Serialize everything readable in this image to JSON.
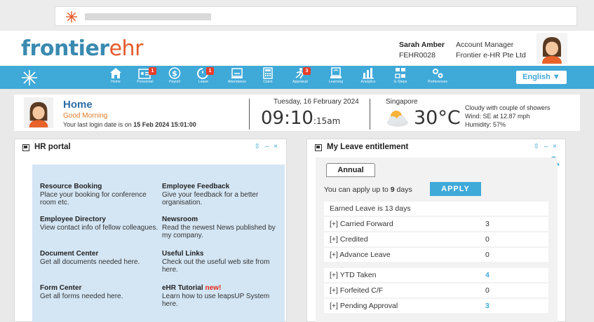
{
  "header": {
    "logo_part1": "frontier",
    "logo_part2": "ehr",
    "user_name": "Sarah Amber",
    "user_id": "FEHR0028",
    "role": "Account Manager",
    "company": "Frontier e-HR Pte Ltd"
  },
  "toolbar": {
    "items": [
      {
        "label": "Home",
        "badge": ""
      },
      {
        "label": "Personnel",
        "badge": "1"
      },
      {
        "label": "Payroll",
        "badge": ""
      },
      {
        "label": "Leave",
        "badge": "1"
      },
      {
        "label": "Attendance",
        "badge": ""
      },
      {
        "label": "Claim",
        "badge": ""
      },
      {
        "label": "Appraisal",
        "badge": "3"
      },
      {
        "label": "Learning",
        "badge": ""
      },
      {
        "label": "Analytics",
        "badge": ""
      },
      {
        "label": "G-Steps",
        "badge": ""
      },
      {
        "label": "Preferences",
        "badge": ""
      }
    ],
    "language": "English ▼"
  },
  "info": {
    "title": "Home",
    "greeting": "Good Morning",
    "last_login_prefix": "Your last login date is on",
    "last_login_value": "15 Feb 2024  15:01:00",
    "date": "Tuesday, 16 February 2024",
    "time_main": "09:10",
    "time_suffix": ":15am",
    "city": "Singapore",
    "temperature": "30°C",
    "weather_line1": "Cloudy with couple of showers",
    "weather_line2": "Wind: SE at 12.87 mph",
    "weather_line3": "Humidity: 57%"
  },
  "hr_portal": {
    "title": "HR portal",
    "controls": "⇳ – ×",
    "items": [
      {
        "title": "Resource Booking",
        "desc": "Place your booking for conference room etc."
      },
      {
        "title": "Employee Feedback",
        "desc": "Give your feedback for a better organisation."
      },
      {
        "title": "Employee Directory",
        "desc": "View contact info of fellow colleagues."
      },
      {
        "title": "Newsroom",
        "desc": "Read the newest News published by my company."
      },
      {
        "title": "Document Center",
        "desc": "Get all documents needed here."
      },
      {
        "title": "Useful Links",
        "desc": "Check out the useful web site from here."
      },
      {
        "title": "Form Center",
        "desc": "Get all forms needed here."
      },
      {
        "title": "eHR Tutorial",
        "badge": "new!",
        "desc": "Learn how to use leapsUP System here."
      }
    ]
  },
  "leave": {
    "title": "My Leave entitlement",
    "controls": "⇳ – ×",
    "tab": "Annual",
    "apply_prefix": "You can apply up to",
    "apply_days": "9",
    "apply_suffix": "days",
    "apply_button": "APPLY",
    "earned": "Earned Leave is 13 days",
    "rows": [
      {
        "label": "[+]  Carried Forward",
        "value": "3",
        "highlight": false
      },
      {
        "label": "[+]  Credited",
        "value": "0",
        "highlight": false
      },
      {
        "label": "[+]  Advance Leave",
        "value": "0",
        "highlight": false
      },
      {
        "label": "[+]  YTD Taken",
        "value": "4",
        "highlight": true
      },
      {
        "label": "[+]  Forfeited C/F",
        "value": "0",
        "highlight": false
      },
      {
        "label": "[+]  Pending Approval",
        "value": "3",
        "highlight": true
      }
    ]
  },
  "colors": {
    "accent": "#3fa9d8",
    "brand_blue": "#3a8ab0",
    "brand_orange": "#e65a2a",
    "badge": "#e83d2a"
  }
}
